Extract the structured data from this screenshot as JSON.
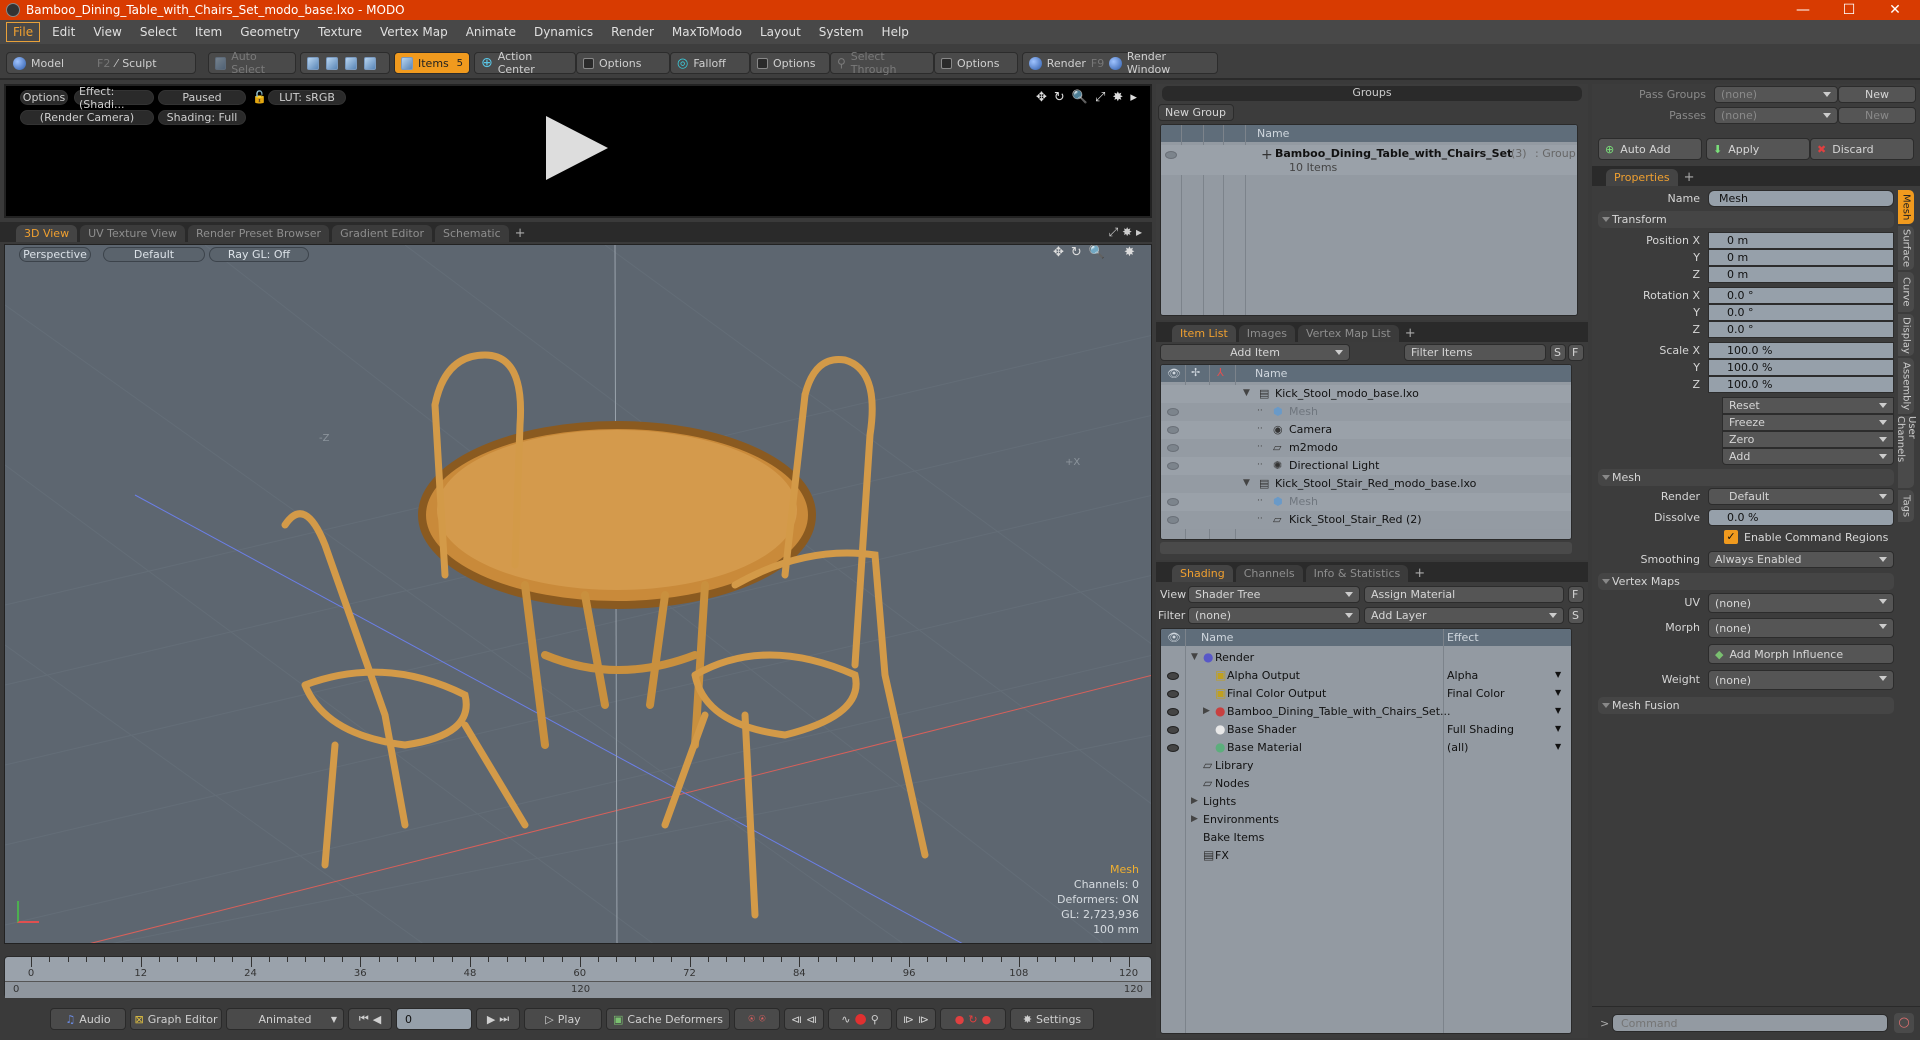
{
  "window": {
    "title": "Bamboo_Dining_Table_with_Chairs_Set_modo_base.lxo - MODO",
    "minimize": "—",
    "maximize": "☐",
    "close": "✕"
  },
  "menu": [
    "File",
    "Edit",
    "View",
    "Select",
    "Item",
    "Geometry",
    "Texture",
    "Vertex Map",
    "Animate",
    "Dynamics",
    "Render",
    "MaxToModo",
    "Layout",
    "System",
    "Help"
  ],
  "toolbar": {
    "model": "Model",
    "model_key": "F2",
    "sculpt": "Sculpt",
    "auto_select": "Auto Select",
    "items": "Items",
    "items_key": "5",
    "action_center": "Action Center",
    "options1": "Options",
    "falloff": "Falloff",
    "options2": "Options",
    "select_through": "Select Through",
    "options3": "Options",
    "render": "Render",
    "render_key": "F9",
    "render_window": "Render Window"
  },
  "preview": {
    "options": "Options",
    "effect": "Effect: (Shadi...",
    "paused": "Paused",
    "lut": "LUT: sRGB",
    "camera": "(Render Camera)",
    "shading": "Shading: Full"
  },
  "view_tabs": [
    "3D View",
    "UV Texture View",
    "Render Preset Browser",
    "Gradient Editor",
    "Schematic"
  ],
  "viewport": {
    "perspective": "Perspective",
    "default": "Default",
    "raygl": "Ray GL: Off",
    "axis_z": "-Z",
    "axis_x": "+X",
    "hud": {
      "type": "Mesh",
      "channels": "Channels: 0",
      "deformers": "Deformers: ON",
      "gl": "GL: 2,723,936",
      "scale": "100 mm"
    }
  },
  "timeline": {
    "ticks": [
      0,
      12,
      24,
      36,
      48,
      60,
      72,
      84,
      96,
      108,
      120
    ],
    "range_start": "0",
    "range_mid": "120",
    "range_end": "120"
  },
  "transport": {
    "audio": "Audio",
    "graph_editor": "Graph Editor",
    "animated": "Animated",
    "frame": "0",
    "play": "Play",
    "cache": "Cache Deformers",
    "settings": "Settings"
  },
  "groups": {
    "title": "Groups",
    "new_group": "New Group",
    "col_name": "Name",
    "row_name": "Bamboo_Dining_Table_with_Chairs_Set",
    "row_count": "(3)",
    "row_type": ": Group",
    "row_sub": "10 Items"
  },
  "item_tabs": [
    "Item List",
    "Images",
    "Vertex Map List"
  ],
  "item_list": {
    "add_item": "Add Item",
    "filter": "Filter Items",
    "s": "S",
    "f": "F",
    "col_name": "Name",
    "rows": [
      {
        "name": "Kick_Stool_modo_base.lxo",
        "indent": 0,
        "eye": false,
        "dim": false
      },
      {
        "name": "Mesh",
        "indent": 1,
        "eye": true,
        "dim": true
      },
      {
        "name": "Camera",
        "indent": 1,
        "eye": true,
        "dim": false
      },
      {
        "name": "m2modo",
        "indent": 1,
        "eye": true,
        "dim": false
      },
      {
        "name": "Directional Light",
        "indent": 1,
        "eye": true,
        "dim": false
      },
      {
        "name": "Kick_Stool_Stair_Red_modo_base.lxo",
        "indent": 0,
        "eye": false,
        "dim": false
      },
      {
        "name": "Mesh",
        "indent": 1,
        "eye": true,
        "dim": true
      },
      {
        "name": "Kick_Stool_Stair_Red (2)",
        "indent": 1,
        "eye": true,
        "dim": false
      }
    ]
  },
  "shading_tabs": [
    "Shading",
    "Channels",
    "Info & Statistics"
  ],
  "shading": {
    "view_label": "View",
    "view_value": "Shader Tree",
    "assign": "Assign Material",
    "f": "F",
    "filter_label": "Filter",
    "filter_value": "(none)",
    "add_layer": "Add Layer",
    "s": "S",
    "col_name": "Name",
    "col_effect": "Effect",
    "rows": [
      {
        "name": "Render",
        "effect": "",
        "indent": 0,
        "eye": false
      },
      {
        "name": "Alpha Output",
        "effect": "Alpha",
        "indent": 1,
        "eye": true
      },
      {
        "name": "Final Color Output",
        "effect": "Final Color",
        "indent": 1,
        "eye": true
      },
      {
        "name": "Bamboo_Dining_Table_with_Chairs_Set...",
        "effect": "",
        "indent": 1,
        "eye": true
      },
      {
        "name": "Base Shader",
        "effect": "Full Shading",
        "indent": 1,
        "eye": true
      },
      {
        "name": "Base Material",
        "effect": "(all)",
        "indent": 1,
        "eye": true
      },
      {
        "name": "Library",
        "effect": "",
        "indent": 0,
        "eye": false
      },
      {
        "name": "Nodes",
        "effect": "",
        "indent": 0,
        "eye": false
      },
      {
        "name": "Lights",
        "effect": "",
        "indent": 0,
        "eye": false
      },
      {
        "name": "Environments",
        "effect": "",
        "indent": 0,
        "eye": false
      },
      {
        "name": "Bake Items",
        "effect": "",
        "indent": 0,
        "eye": false
      },
      {
        "name": "FX",
        "effect": "",
        "indent": 0,
        "eye": false
      }
    ]
  },
  "passes": {
    "pass_groups": "Pass Groups",
    "pass_groups_val": "(none)",
    "new": "New",
    "passes": "Passes",
    "passes_val": "(none)",
    "new2": "New",
    "auto_add": "Auto Add",
    "apply": "Apply",
    "discard": "Discard"
  },
  "properties": {
    "tab": "Properties",
    "name_label": "Name",
    "name_value": "Mesh",
    "transform": "Transform",
    "position_label": "Position X",
    "pos": [
      "0 m",
      "0 m",
      "0 m"
    ],
    "rotation_label": "Rotation X",
    "rot": [
      "0.0 °",
      "0.0 °",
      "0.0 °"
    ],
    "scale_label": "Scale X",
    "scl": [
      "100.0 %",
      "100.0 %",
      "100.0 %"
    ],
    "y": "Y",
    "z": "Z",
    "actions": [
      "Reset",
      "Freeze",
      "Zero",
      "Add"
    ],
    "mesh": "Mesh",
    "render_label": "Render",
    "render_value": "Default",
    "dissolve_label": "Dissolve",
    "dissolve_value": "0.0 %",
    "cmd_regions": "Enable Command Regions",
    "smoothing_label": "Smoothing",
    "smoothing_value": "Always Enabled",
    "vertex_maps": "Vertex Maps",
    "uv_label": "UV",
    "uv_value": "(none)",
    "morph_label": "Morph",
    "morph_value": "(none)",
    "add_morph": "Add Morph Influence",
    "weight_label": "Weight",
    "weight_value": "(none)",
    "mesh_fusion": "Mesh Fusion",
    "side_tabs": [
      "Mesh",
      "Surface",
      "Curve",
      "Display",
      "Assembly",
      "User Channels",
      "Tags"
    ]
  },
  "command": {
    "prompt": ">",
    "placeholder": "Command"
  }
}
